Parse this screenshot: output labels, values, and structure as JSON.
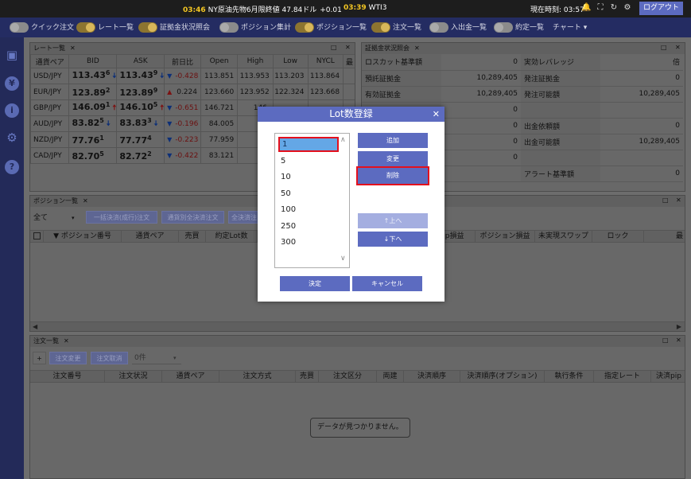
{
  "ticker": {
    "item1": {
      "time": "03:46",
      "text": "NY原油先物6月限終値",
      "value": "47.84ドル",
      "change": "+0.01"
    },
    "item2": {
      "time": "03:39",
      "text": "WTI3"
    },
    "clock": "現在時刻: 03:57",
    "logout": "ログアウト"
  },
  "nav": {
    "toggles": [
      {
        "label": "クイック注文",
        "on": false
      },
      {
        "label": "レート一覧",
        "on": true
      },
      {
        "label": "証拠金状況照会",
        "on": true
      },
      {
        "label": "ポジション集計",
        "on": false
      },
      {
        "label": "ポジション一覧",
        "on": true
      },
      {
        "label": "注文一覧",
        "on": true
      },
      {
        "label": "入出金一覧",
        "on": false
      },
      {
        "label": "約定一覧",
        "on": false
      }
    ],
    "chart": "チャート"
  },
  "rate_panel": {
    "title": "レート一覧",
    "headers": [
      "通貨ペア",
      "BID",
      "ASK",
      "前日比",
      "Open",
      "High",
      "Low",
      "NYCL",
      "最"
    ],
    "rows": [
      {
        "pair": "USD/JPY",
        "bid_main": "113.43",
        "bid_pip": "6",
        "bid_dir": "down",
        "ask_main": "113.43",
        "ask_pip": "9",
        "ask_dir": "down",
        "chg_dir": "down",
        "chg": "-0.428",
        "open": "113.851",
        "high": "113.953",
        "low": "113.203",
        "nycl": "113.864"
      },
      {
        "pair": "EUR/JPY",
        "bid_main": "123.89",
        "bid_pip": "2",
        "bid_dir": "",
        "ask_main": "123.89",
        "ask_pip": "9",
        "ask_dir": "",
        "chg_dir": "up",
        "chg": "0.224",
        "open": "123.660",
        "high": "123.952",
        "low": "122.324",
        "nycl": "123.668"
      },
      {
        "pair": "GBP/JPY",
        "bid_main": "146.09",
        "bid_pip": "1",
        "bid_dir": "up",
        "ask_main": "146.10",
        "ask_pip": "5",
        "ask_dir": "up",
        "chg_dir": "down",
        "chg": "-0.651",
        "open": "146.721",
        "high": "146.",
        "low": "",
        "nycl": ""
      },
      {
        "pair": "AUD/JPY",
        "bid_main": "83.82",
        "bid_pip": "5",
        "bid_dir": "down",
        "ask_main": "83.83",
        "ask_pip": "3",
        "ask_dir": "down",
        "chg_dir": "down",
        "chg": "-0.196",
        "open": "84.005",
        "high": "84.",
        "low": "",
        "nycl": ""
      },
      {
        "pair": "NZD/JPY",
        "bid_main": "77.76",
        "bid_pip": "1",
        "bid_dir": "",
        "ask_main": "77.77",
        "ask_pip": "4",
        "ask_dir": "",
        "chg_dir": "down",
        "chg": "-0.223",
        "open": "77.959",
        "high": "77.",
        "low": "",
        "nycl": ""
      },
      {
        "pair": "CAD/JPY",
        "bid_main": "82.70",
        "bid_pip": "5",
        "bid_dir": "",
        "ask_main": "82.72",
        "ask_pip": "2",
        "ask_dir": "",
        "chg_dir": "down",
        "chg": "-0.422",
        "open": "83.121",
        "high": "83.",
        "low": "",
        "nycl": ""
      }
    ]
  },
  "margin_panel": {
    "title": "証拠金状況照会",
    "rows": [
      [
        "ロスカット基準額",
        "0",
        "実効レバレッジ",
        "倍"
      ],
      [
        "預託証拠金",
        "10,289,405",
        "発注証拠金",
        "0"
      ],
      [
        "有効証拠金",
        "10,289,405",
        "発注可能額",
        "10,289,405"
      ],
      [
        "",
        "0",
        "",
        ""
      ],
      [
        "",
        "0",
        "出金依頼額",
        "0"
      ],
      [
        "",
        "0",
        "出金可能額",
        "10,289,405"
      ],
      [
        "",
        "0",
        "",
        ""
      ],
      [
        "",
        "",
        "アラート基準額",
        "0"
      ]
    ]
  },
  "position_panel": {
    "title": "ポジション一覧",
    "filter": "全て",
    "btn1": "一括決済(成行)注文",
    "btn2": "通貨別全決済注文",
    "btn3": "全決済注",
    "headers": [
      "▼ ポジション番号",
      "通貨ペア",
      "売買",
      "約定Lot数",
      "pip損益",
      "ポジション損益",
      "未実現スワップ",
      "ロック",
      "最"
    ]
  },
  "order_panel": {
    "title": "注文一覧",
    "plus": "+",
    "btn_change": "注文変更",
    "btn_cancel": "注文取消",
    "count": "0件",
    "headers": [
      "注文番号",
      "注文状況",
      "通貨ペア",
      "注文方式",
      "売買",
      "注文区分",
      "両建",
      "決済順序",
      "決済順序(オプション)",
      "執行条件",
      "指定レート",
      "決済pip"
    ],
    "empty": "データが見つかりません。"
  },
  "modal": {
    "title": "Lot数登録",
    "lots": [
      "1",
      "5",
      "10",
      "50",
      "100",
      "250",
      "300"
    ],
    "selected": "1",
    "add": "追加",
    "edit": "変更",
    "delete": "削除",
    "up": "↑上へ",
    "down": "↓下へ",
    "ok": "決定",
    "cancel": "キャンセル"
  }
}
